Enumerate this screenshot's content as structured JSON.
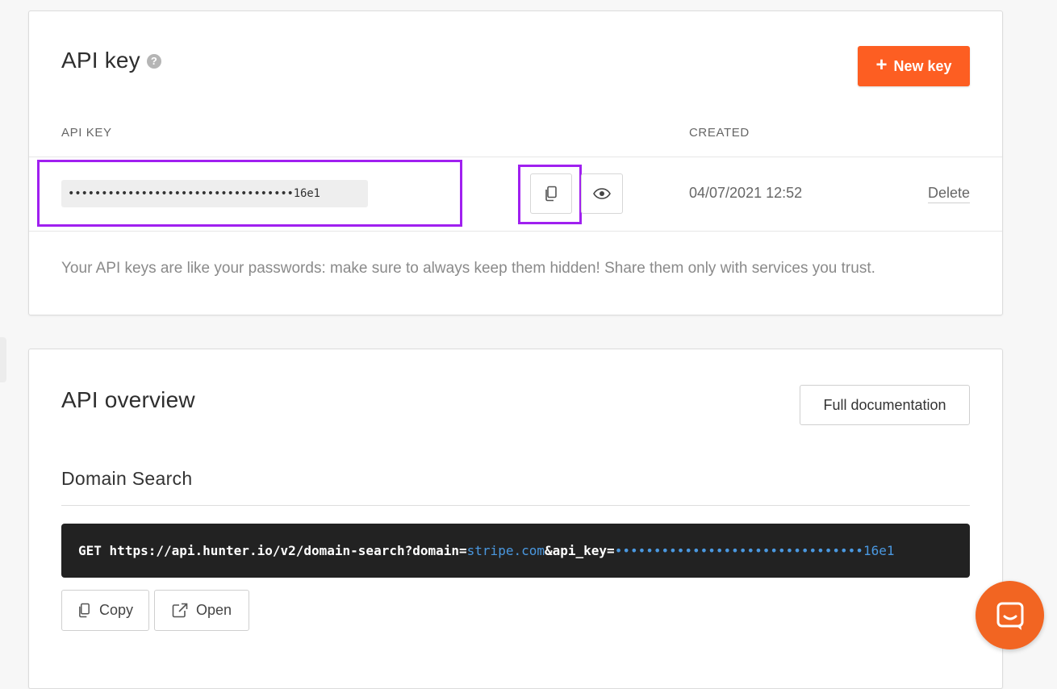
{
  "api_key_card": {
    "title": "API key",
    "help_glyph": "?",
    "new_key_button": {
      "icon": "plus-icon",
      "label": "New key"
    },
    "columns": {
      "api_key": "API KEY",
      "created": "CREATED"
    },
    "row": {
      "masked_key": "••••••••••••••••••••••••••••••••••16e1",
      "created": "04/07/2021 12:52",
      "delete_label": "Delete"
    },
    "note": "Your API keys are like your passwords: make sure to always keep them hidden! Share them only with services you trust."
  },
  "overview_card": {
    "title": "API overview",
    "docs_button": "Full documentation",
    "section_title": "Domain Search",
    "request": {
      "method": "GET",
      "url_prefix": "https://api.hunter.io/v2/domain-search?domain=",
      "domain": "stripe.com",
      "param": "&api_key=",
      "key_masked": "••••••••••••••••••••••••••••••••16e1"
    },
    "copy_label": "Copy",
    "open_label": "Open"
  },
  "colors": {
    "accent": "#fd5e22",
    "highlight": "#a020f0",
    "code_bg": "#222222",
    "code_link": "#4a98e0",
    "chat": "#f26522"
  }
}
